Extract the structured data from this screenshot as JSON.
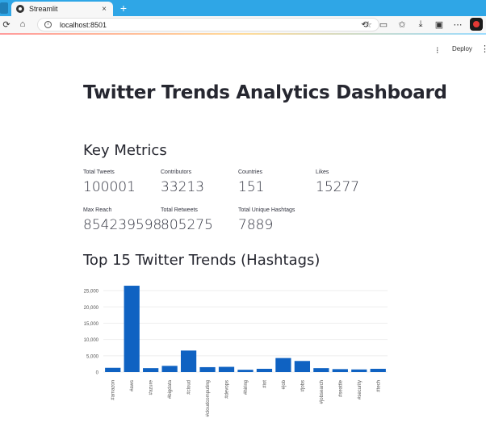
{
  "browser": {
    "tab_title": "Streamlit",
    "tab_close": "×",
    "new_tab": "+",
    "url": "localhost:8501"
  },
  "streamlit_header": {
    "deploy_label": "Deploy"
  },
  "dashboard": {
    "title": "Twitter Trends Analytics Dashboard",
    "metrics_heading": "Key Metrics",
    "metrics": [
      {
        "label": "Total Tweets",
        "value": "100001"
      },
      {
        "label": "Contributors",
        "value": "33213"
      },
      {
        "label": "Countries",
        "value": "151"
      },
      {
        "label": "Likes",
        "value": "15277"
      },
      {
        "label": "Max Reach",
        "value": "854239598"
      },
      {
        "label": "Total Retweets",
        "value": "805275"
      },
      {
        "label": "Total Unique Hashtags",
        "value": "7889"
      }
    ],
    "chart_heading": "Top 15 Twitter Trends (Hashtags)"
  },
  "colors": {
    "bar": "#0f62c2",
    "text": "#262730",
    "grid": "#eeeeee"
  },
  "chart_data": {
    "type": "bar",
    "categories": [
      "#amazon",
      "#aws",
      "#azure",
      "#bigdata",
      "#cloud",
      "#cloudcomputing",
      "#devops",
      "#hiring",
      "#iot",
      "#job",
      "#jobs",
      "#jobsearch",
      "#seattle",
      "#security",
      "#tech"
    ],
    "values": [
      1300,
      26500,
      1200,
      1900,
      6600,
      1500,
      1600,
      700,
      1000,
      4300,
      3400,
      1200,
      900,
      800,
      1000
    ],
    "yticks": [
      0,
      5000,
      10000,
      15000,
      20000,
      25000
    ],
    "ytick_labels": [
      "0",
      "5,000",
      "10,000",
      "15,000",
      "20,000",
      "25,000"
    ],
    "ylim": [
      0,
      27500
    ],
    "grid": true,
    "title": "",
    "xlabel": "",
    "ylabel": ""
  }
}
